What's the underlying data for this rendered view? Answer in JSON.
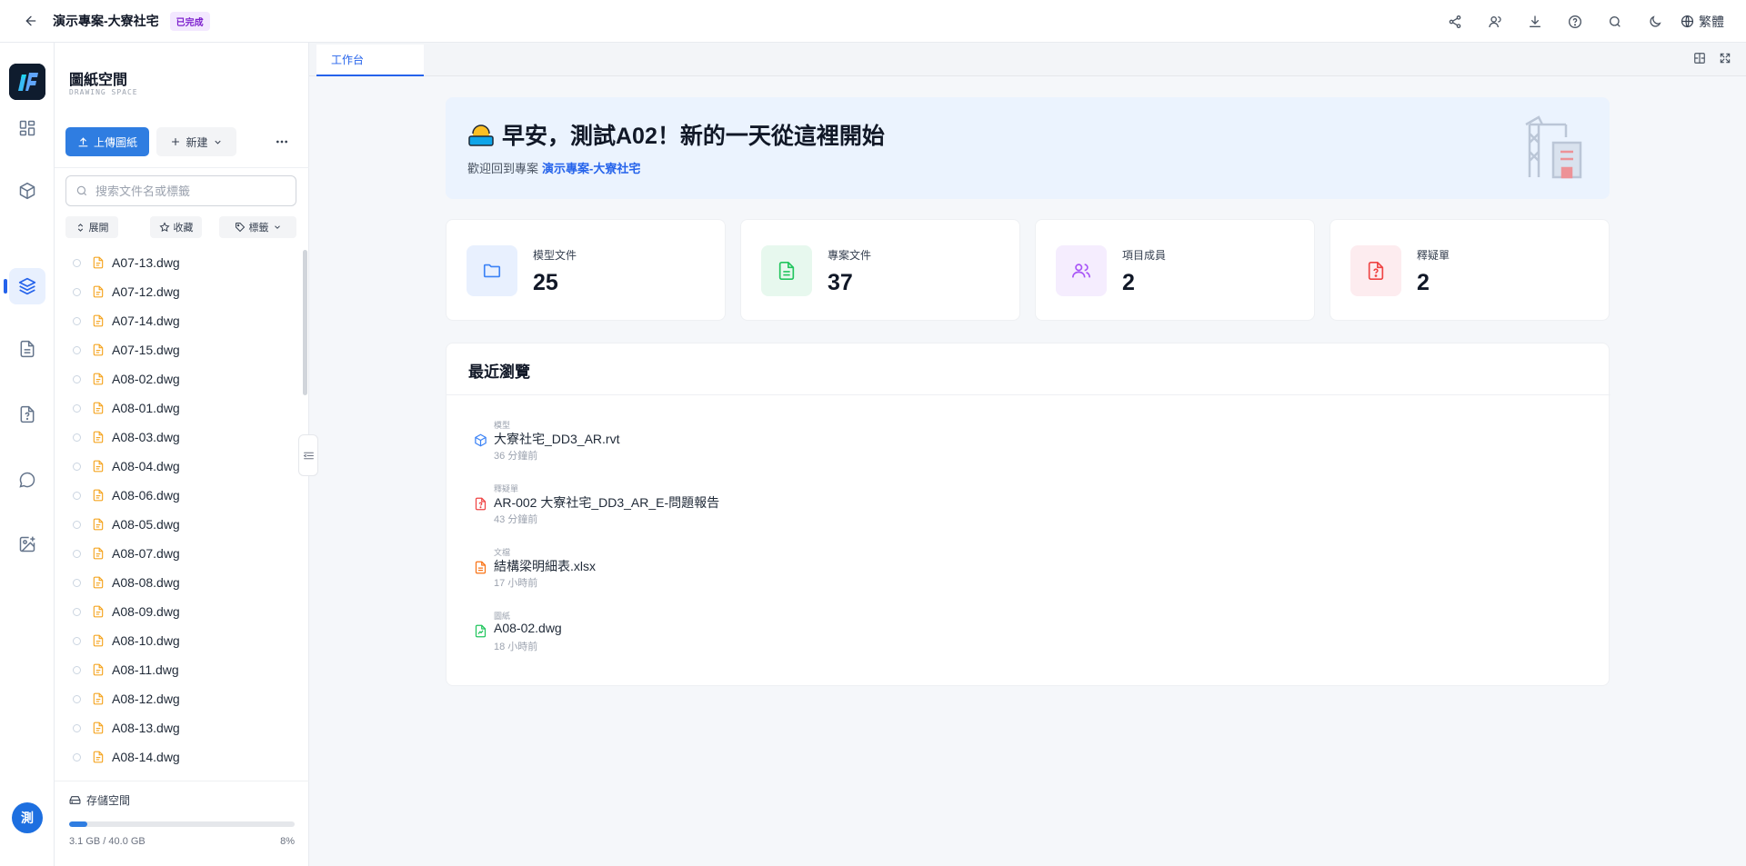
{
  "header": {
    "project_title": "演示專案-大寮社宅",
    "status_badge": "已完成",
    "language_label": "繁體"
  },
  "panel": {
    "title": "圖紙空間",
    "subtitle": "DRAWING SPACE",
    "upload_label": "上傳圖紙",
    "new_label": "新建",
    "search_placeholder": "搜索文件名或標籤",
    "filters": {
      "expand": "展開",
      "favorite": "收藏",
      "tags": "標籤"
    },
    "files": [
      "A07-13.dwg",
      "A07-12.dwg",
      "A07-14.dwg",
      "A07-15.dwg",
      "A08-02.dwg",
      "A08-01.dwg",
      "A08-03.dwg",
      "A08-04.dwg",
      "A08-06.dwg",
      "A08-05.dwg",
      "A08-07.dwg",
      "A08-08.dwg",
      "A08-09.dwg",
      "A08-10.dwg",
      "A08-11.dwg",
      "A08-12.dwg",
      "A08-13.dwg",
      "A08-14.dwg"
    ],
    "storage": {
      "label": "存儲空間",
      "used_text": "3.1 GB / 40.0 GB",
      "percent_text": "8%",
      "percent": 0.08
    }
  },
  "rail": {
    "avatar_text": "測"
  },
  "main": {
    "tab_label": "工作台",
    "welcome": {
      "greeting": "早安，測試A02！新的一天從這裡開始",
      "sub_prefix": "歡迎回到專案",
      "project_link": "演示專案-大寮社宅"
    },
    "stats": [
      {
        "label": "模型文件",
        "value": "25",
        "icon": "folder-icon",
        "color": "#3b82f6",
        "bg": "#e8f0fe"
      },
      {
        "label": "專案文件",
        "value": "37",
        "icon": "document-icon",
        "color": "#22c55e",
        "bg": "#e7f8ee"
      },
      {
        "label": "項目成員",
        "value": "2",
        "icon": "users-icon",
        "color": "#a855f7",
        "bg": "#f5edfe"
      },
      {
        "label": "釋疑單",
        "value": "2",
        "icon": "question-file-icon",
        "color": "#ef4444",
        "bg": "#fdecef"
      }
    ],
    "recent": {
      "title": "最近瀏覽",
      "items": [
        {
          "type": "模型",
          "name": "大寮社宅_DD3_AR.rvt",
          "time": "36 分鐘前",
          "icon": "cube-icon",
          "color": "#3b82f6"
        },
        {
          "type": "釋疑單",
          "name": "AR-002 大寮社宅_DD3_AR_E-問題報告",
          "time": "43 分鐘前",
          "icon": "question-file-icon",
          "color": "#ef4444"
        },
        {
          "type": "文檔",
          "name": "結構梁明細表.xlsx",
          "time": "17 小時前",
          "icon": "document-icon",
          "color": "#f97316"
        },
        {
          "type": "圖紙",
          "name": "A08-02.dwg",
          "time": "18 小時前",
          "icon": "drawing-file-icon",
          "color": "#22c55e"
        }
      ]
    }
  },
  "colors": {
    "accent": "#2563eb",
    "file_icon": "#f5a623"
  }
}
